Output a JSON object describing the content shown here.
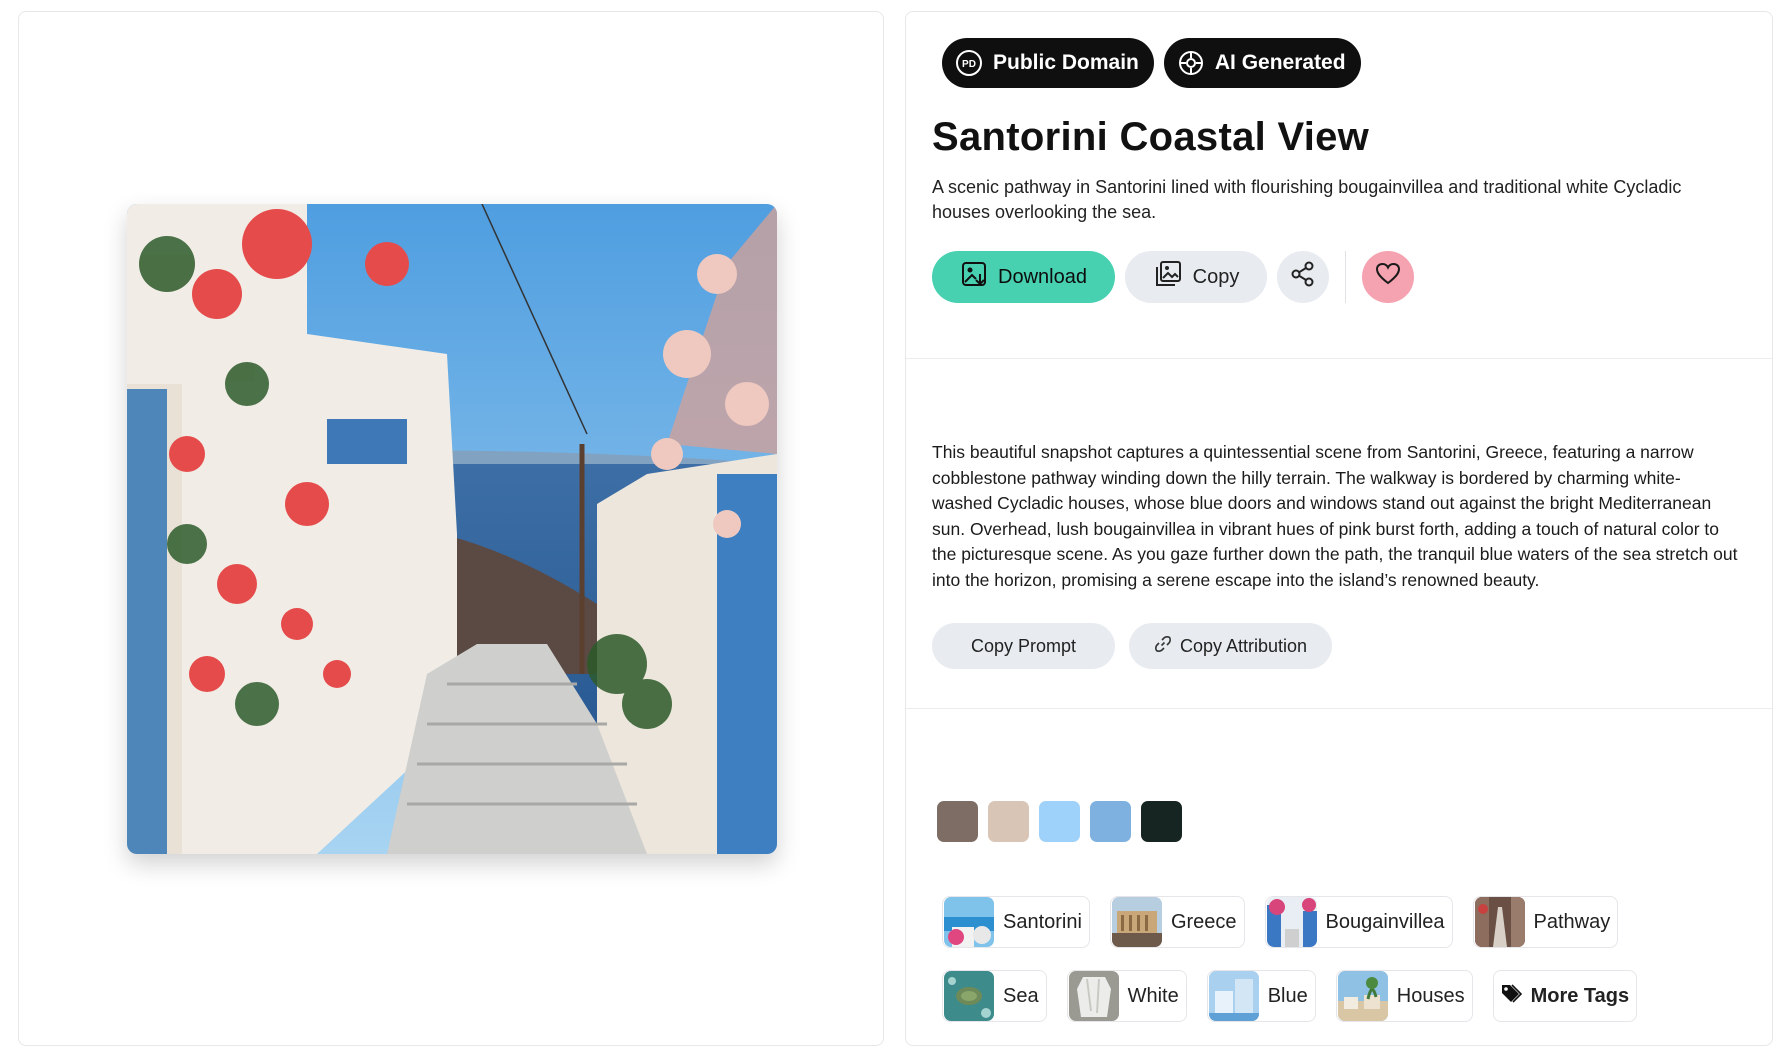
{
  "badges": [
    {
      "label": "Public Domain",
      "icon": "public-domain-icon"
    },
    {
      "label": "AI Generated",
      "icon": "ai-chip-icon"
    }
  ],
  "title": "Santorini Coastal View",
  "subtitle": "A scenic pathway in Santorini lined with flourishing bougainvillea and traditional white Cycladic houses overlooking the sea.",
  "actions": {
    "download": "Download",
    "copy": "Copy",
    "share_icon": "share-icon",
    "favorite_icon": "heart-icon"
  },
  "description": "This beautiful snapshot captures a quintessential scene from Santorini, Greece, featuring a narrow cobblestone pathway winding down the hilly terrain. The walkway is bordered by charming white-washed Cycladic houses, whose blue doors and windows stand out against the bright Mediterranean sun. Overhead, lush bougainvillea in vibrant hues of pink burst forth, adding a touch of natural color to the picturesque scene. As you gaze further down the path, the tranquil blue waters of the sea stretch out into the horizon, promising a serene escape into the island’s renowned beauty.",
  "secondary_actions": {
    "copy_prompt": "Copy Prompt",
    "copy_attribution": "Copy Attribution"
  },
  "palette": [
    "#7d6d64",
    "#d8c5b6",
    "#9fd2fb",
    "#7eb1e0",
    "#162522"
  ],
  "tags_row1": [
    {
      "label": "Santorini"
    },
    {
      "label": "Greece"
    },
    {
      "label": "Bougainvillea"
    },
    {
      "label": "Pathway"
    }
  ],
  "tags_row2": [
    {
      "label": "Sea"
    },
    {
      "label": "White"
    },
    {
      "label": "Blue"
    },
    {
      "label": "Houses"
    }
  ],
  "more_tags": "More Tags"
}
